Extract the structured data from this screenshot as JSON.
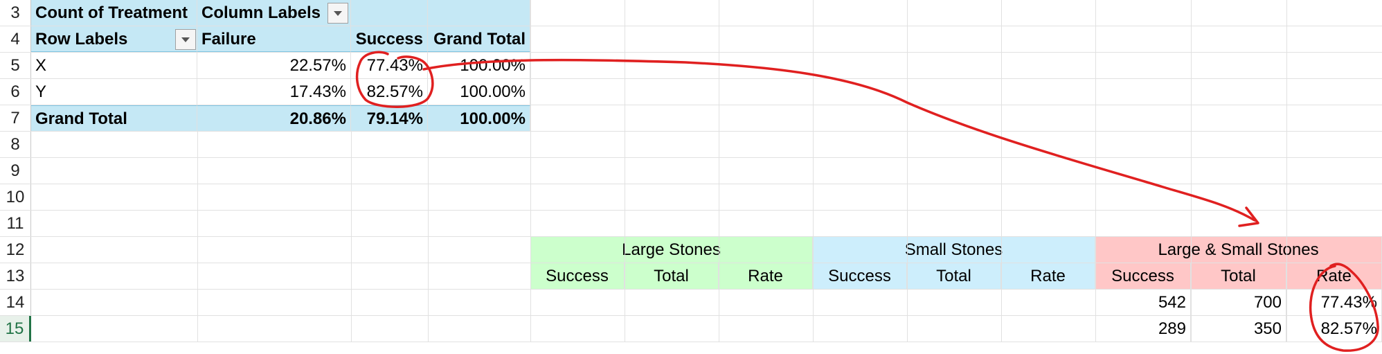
{
  "row_headers": [
    "3",
    "4",
    "5",
    "6",
    "7",
    "8",
    "9",
    "10",
    "11",
    "12",
    "13",
    "14",
    "15"
  ],
  "pivot": {
    "value_header": "Count of Treatment",
    "column_labels": "Column Labels",
    "row_labels": "Row Labels",
    "col_failure": "Failure",
    "col_success": "Success",
    "col_grand_total": "Grand Total",
    "rows": [
      {
        "label": "X",
        "failure": "22.57%",
        "success": "77.43%",
        "total": "100.00%"
      },
      {
        "label": "Y",
        "failure": "17.43%",
        "success": "82.57%",
        "total": "100.00%"
      }
    ],
    "grand_total": {
      "label": "Grand Total",
      "failure": "20.86%",
      "success": "79.14%",
      "total": "100.00%"
    }
  },
  "groups": {
    "large": "Large Stones",
    "small": "Small Stones",
    "combined": "Large & Small Stones"
  },
  "subheaders": [
    "Success",
    "Total",
    "Rate",
    "Success",
    "Total",
    "Rate",
    "Success",
    "Total",
    "Rate"
  ],
  "combined_rows": [
    {
      "success": "542",
      "total": "700",
      "rate": "77.43%"
    },
    {
      "success": "289",
      "total": "350",
      "rate": "82.57%"
    }
  ],
  "colors": {
    "pivot_fill": "#c5e8f5",
    "large_fill": "#ccffcc",
    "small_fill": "#cdeefc",
    "combined_fill": "#ffc7c7",
    "annotation_ink": "#e02020",
    "selected_row": "#217346"
  },
  "icons": {
    "dropdown": "chevron-down-icon"
  }
}
